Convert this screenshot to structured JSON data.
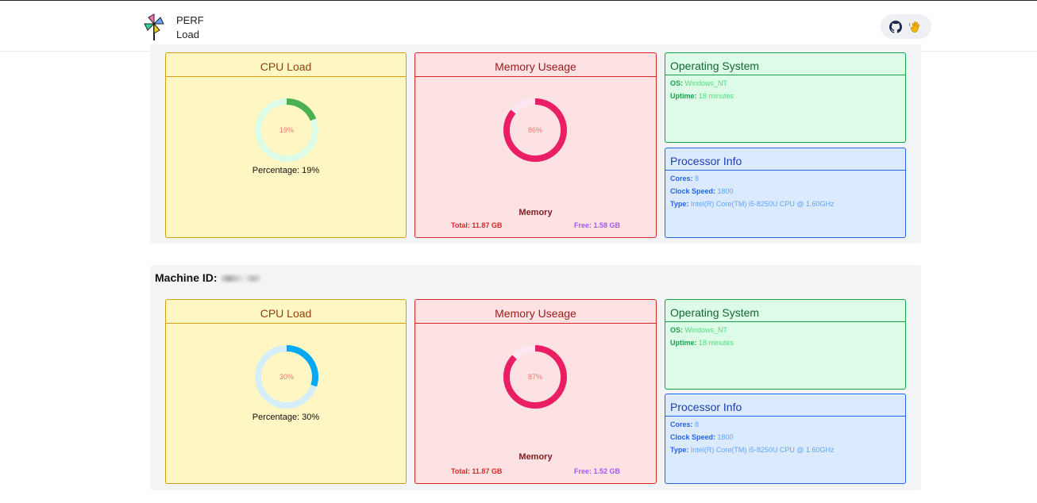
{
  "header": {
    "logo_icon": "pinwheel-icon",
    "brand_line1": "PERF",
    "brand_line2": "Load",
    "github_icon": "github-icon",
    "wave_icon": "waving-hand-icon"
  },
  "machines": [
    {
      "machine_id_label": "",
      "cpu": {
        "title": "CPU Load",
        "percent": 19,
        "percent_text": "19%",
        "caption": "Percentage: 19%",
        "color": "#4caf50",
        "track": "#dcfce7"
      },
      "memory": {
        "title": "Memory Useage",
        "percent": 86,
        "percent_text": "86%",
        "caption": "Memory",
        "total": "Total: 11.87 GB",
        "free": "Free: 1.58 GB",
        "color": "#e91e63",
        "track": "#fce7f3"
      },
      "os": {
        "title": "Operating System",
        "os_label": "OS:",
        "os_value": "Windows_NT",
        "uptime_label": "Uptime:",
        "uptime_value": "18 minutes"
      },
      "processor": {
        "title": "Processor Info",
        "cores_label": "Cores:",
        "cores_value": "8",
        "clock_label": "Clock Speed:",
        "clock_value": "1800",
        "type_label": "Type:",
        "type_value": "Intel(R) Core(TM) i5-8250U CPU @ 1.60GHz"
      }
    },
    {
      "machine_id_label": "Machine ID:",
      "cpu": {
        "title": "CPU Load",
        "percent": 30,
        "percent_text": "30%",
        "caption": "Percentage: 30%",
        "color": "#03a9f4",
        "track": "#d6eefa"
      },
      "memory": {
        "title": "Memory Useage",
        "percent": 87,
        "percent_text": "87%",
        "caption": "Memory",
        "total": "Total: 11.87 GB",
        "free": "Free: 1.52 GB",
        "color": "#e91e63",
        "track": "#fce7f3"
      },
      "os": {
        "title": "Operating System",
        "os_label": "OS:",
        "os_value": "Windows_NT",
        "uptime_label": "Uptime:",
        "uptime_value": "18 minutes"
      },
      "processor": {
        "title": "Processor Info",
        "cores_label": "Cores:",
        "cores_value": "8",
        "clock_label": "Clock Speed:",
        "clock_value": "1800",
        "type_label": "Type:",
        "type_value": "Intel(R) Core(TM) i5-8250U CPU @ 1.60GHz"
      }
    }
  ]
}
